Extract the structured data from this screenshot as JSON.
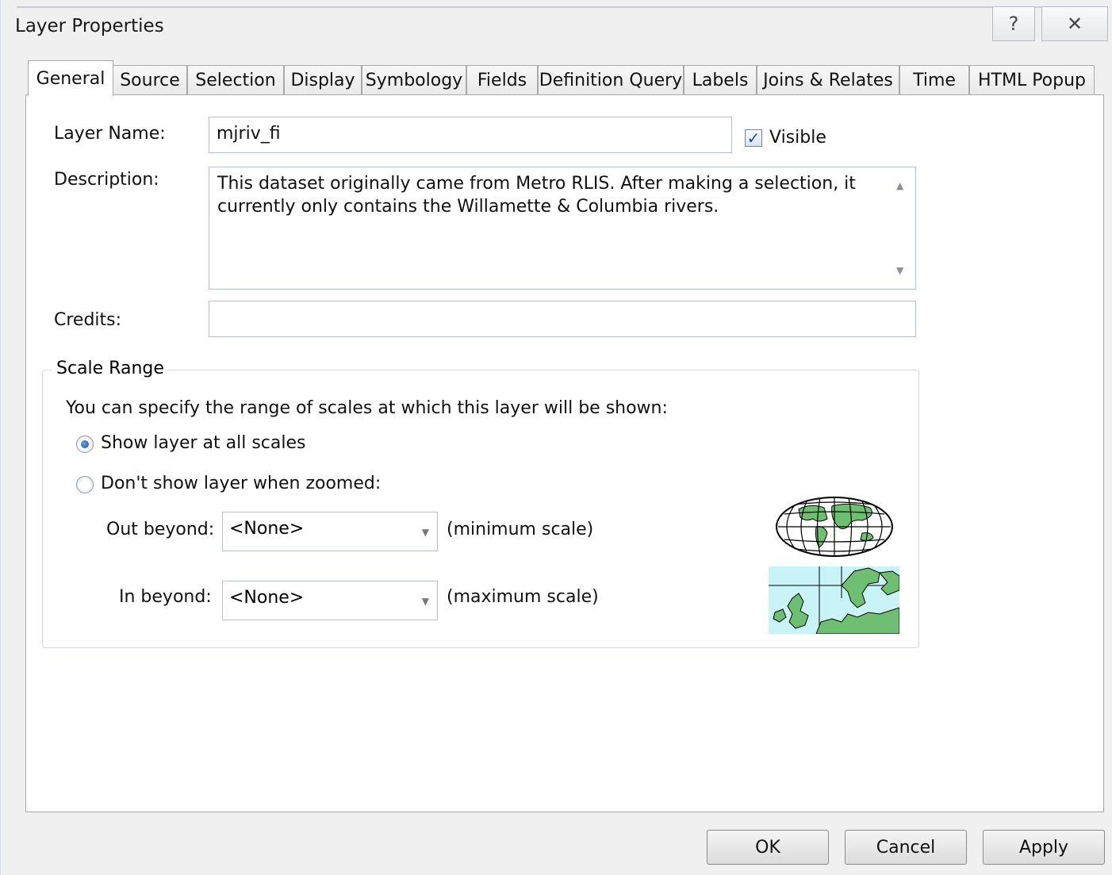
{
  "window": {
    "title": "Layer Properties",
    "help_glyph": "?",
    "close_glyph": "✕"
  },
  "tabs": [
    {
      "label": "General",
      "active": true
    },
    {
      "label": "Source"
    },
    {
      "label": "Selection"
    },
    {
      "label": "Display"
    },
    {
      "label": "Symbology"
    },
    {
      "label": "Fields"
    },
    {
      "label": "Definition Query"
    },
    {
      "label": "Labels"
    },
    {
      "label": "Joins & Relates"
    },
    {
      "label": "Time"
    },
    {
      "label": "HTML Popup"
    }
  ],
  "general": {
    "layer_name_label": "Layer Name:",
    "layer_name_value": "mjriv_fi",
    "visible_label": "Visible",
    "visible_checked": true,
    "description_label": "Description:",
    "description_value": "This dataset originally came from Metro RLIS.  After making a selection, it currently only contains the Willamette & Columbia rivers.",
    "credits_label": "Credits:",
    "credits_value": ""
  },
  "scale_range": {
    "title": "Scale Range",
    "intro": "You can specify the range of scales at which this layer will be shown:",
    "option_all": "Show layer at all scales",
    "option_zoomed": "Don't show layer when zoomed:",
    "selected": "all",
    "out_beyond_label": "Out beyond:",
    "out_beyond_value": "<None>",
    "out_beyond_hint": "(minimum scale)",
    "in_beyond_label": "In beyond:",
    "in_beyond_value": "<None>",
    "in_beyond_hint": "(maximum scale)"
  },
  "buttons": {
    "ok": "OK",
    "cancel": "Cancel",
    "apply": "Apply"
  },
  "colors": {
    "land": "#6fbf73",
    "water": "#c8f4f8",
    "accent": "#1d4f91"
  },
  "icons": [
    "world-globe-icon",
    "europe-map-icon"
  ]
}
